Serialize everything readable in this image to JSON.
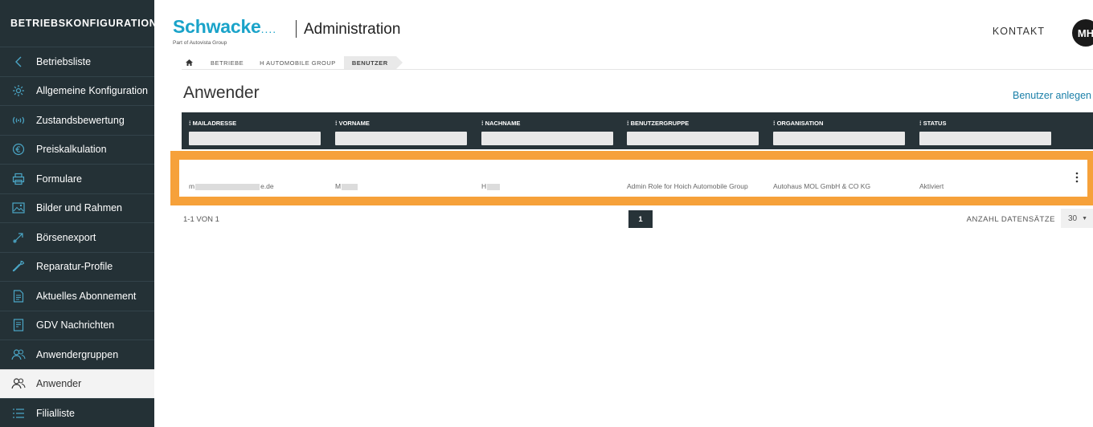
{
  "sidebar": {
    "title": "BETRIEBSKONFIGURATION",
    "items": [
      {
        "label": "Betriebsliste",
        "icon": "chevron-left-icon"
      },
      {
        "label": "Allgemeine Konfiguration",
        "icon": "gear-icon"
      },
      {
        "label": "Zustandsbewertung",
        "icon": "signal-icon"
      },
      {
        "label": "Preiskalkulation",
        "icon": "euro-icon"
      },
      {
        "label": "Formulare",
        "icon": "printer-icon"
      },
      {
        "label": "Bilder und Rahmen",
        "icon": "image-icon"
      },
      {
        "label": "Börsenexport",
        "icon": "export-icon"
      },
      {
        "label": "Reparatur-Profile",
        "icon": "wrench-icon"
      },
      {
        "label": "Aktuelles Abonnement",
        "icon": "document-icon"
      },
      {
        "label": "GDV Nachrichten",
        "icon": "message-doc-icon"
      },
      {
        "label": "Anwendergruppen",
        "icon": "users-icon"
      },
      {
        "label": "Anwender",
        "icon": "users-icon",
        "active": true
      },
      {
        "label": "Filialliste",
        "icon": "list-icon"
      }
    ]
  },
  "header": {
    "logo_text": "Schwacke",
    "logo_dots": "....",
    "logo_sub": "Part of Autovista Group",
    "separator": "|",
    "title": "Administration",
    "kontakt": "KONTAKT",
    "avatar": "MH"
  },
  "breadcrumb": {
    "items": [
      "BETRIEBE",
      "H AUTOMOBILE GROUP",
      "BENUTZER"
    ]
  },
  "page": {
    "title": "Anwender",
    "new_user": "Benutzer anlegen"
  },
  "table": {
    "columns": [
      "MAILADRESSE",
      "VORNAME",
      "NACHNAME",
      "BENUTZERGRUPPE",
      "ORGANISATION",
      "STATUS"
    ],
    "rows": [
      {
        "mail": "m",
        "mail_end": "e.de",
        "vorname": "M",
        "nachname": "H",
        "gruppe": "Admin Role for Hoich Automobile Group",
        "organisation": "Autohaus MOL GmbH & CO KG",
        "status": "Aktiviert"
      }
    ]
  },
  "footer": {
    "count": "1-1 VON 1",
    "page": "1",
    "ds_label": "ANZAHL DATENSÄTZE",
    "ds_value": "30"
  },
  "colors": {
    "sidebar_bg": "#243136",
    "accent": "#1aa3c9",
    "highlight": "#f6a13a",
    "table_head": "#273338"
  }
}
